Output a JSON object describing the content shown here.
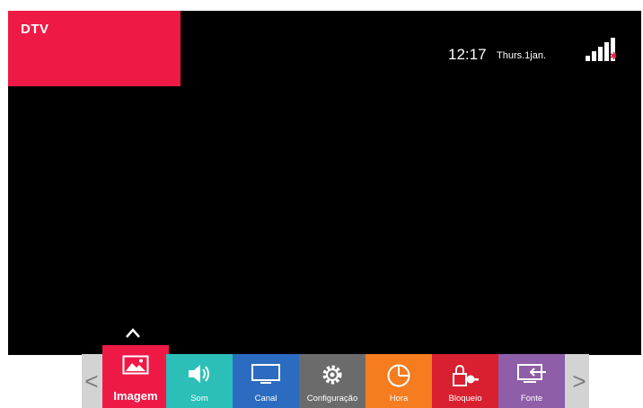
{
  "screen": {
    "source_label": "DTV",
    "clock": "12:17",
    "date": "Thurs.1jan.",
    "signal_icon": "signal-strength-icon"
  },
  "menu": {
    "prev_label": "<",
    "next_label": ">",
    "tiles": [
      {
        "label": "Imagem",
        "icon": "picture-icon",
        "color": "#ee1a45",
        "selected": true
      },
      {
        "label": "Som",
        "icon": "speaker-icon",
        "color": "#2bbfb8"
      },
      {
        "label": "Canal",
        "icon": "monitor-icon",
        "color": "#2c6cc0"
      },
      {
        "label": "Configuração",
        "icon": "gear-icon",
        "color": "#6b6b6b"
      },
      {
        "label": "Hora",
        "icon": "clock-icon",
        "color": "#f57c1f"
      },
      {
        "label": "Bloqueio",
        "icon": "lock-icon",
        "color": "#d92030"
      },
      {
        "label": "Fonte",
        "icon": "input-source-icon",
        "color": "#8e5ea8"
      }
    ]
  },
  "colors": {
    "screen_bg": "#000000",
    "accent": "#ee1a45",
    "menu_bg": "#d3d3d3"
  }
}
